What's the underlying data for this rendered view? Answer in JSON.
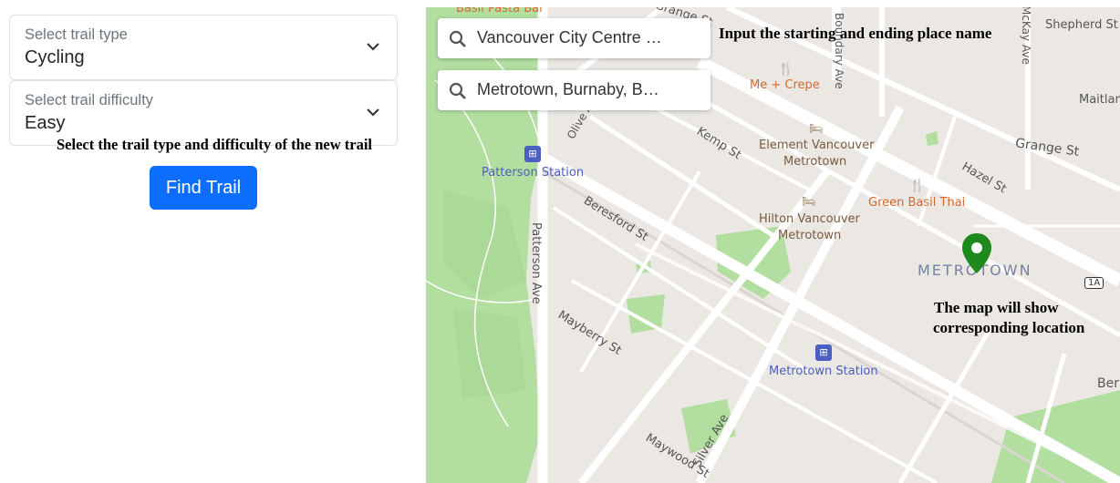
{
  "form": {
    "trail_type": {
      "label": "Select trail type",
      "value": "Cycling"
    },
    "trail_difficulty": {
      "label": "Select trail difficulty",
      "value": "Easy"
    },
    "caption": "Select the trail type and difficulty of the new trail",
    "find_button": "Find Trail"
  },
  "map": {
    "start_search": "Vancouver City Centre …",
    "end_search": "Metrotown, Burnaby, B…",
    "annotation_inputs": "Input the starting and ending place name",
    "annotation_map_line1": "The map will show",
    "annotation_map_line2": "corresponding location",
    "labels": {
      "basil_pasta_bar": "Basil Pasta Bar",
      "grange_st_top": "Grange St",
      "boundary_ave": "Boundary Ave",
      "mckay_ave": "McKay Ave",
      "shepherd_st": "Shepherd St",
      "maitland": "Maitlan",
      "me_crepe": "Me + Crepe",
      "olive_ave": "Olive Ave",
      "kemp_st": "Kemp St",
      "element_vancouver_1": "Element Vancouver",
      "element_vancouver_2": "Metrotown",
      "grange_st": "Grange St",
      "hazel_st": "Hazel St",
      "green_basil_thai": "Green Basil Thai",
      "patterson_station": "Patterson Station",
      "beresford_st": "Beresford St",
      "hilton_1": "Hilton Vancouver",
      "hilton_2": "Metrotown",
      "metrotown": "METROTOWN",
      "route_1a": "1A",
      "patterson_ave": "Patterson Ave",
      "mayberry_st": "Mayberry St",
      "metrotown_station": "Metrotown Station",
      "ber": "Ber",
      "silver_ave": "Silver Ave",
      "maywood_st": "Maywood St"
    },
    "colors": {
      "marker": "#1e8a1e",
      "park": "#b2dea0",
      "road": "#ffffff",
      "transit_label": "#4a5fc1",
      "poi_label": "#d16a2f"
    }
  }
}
